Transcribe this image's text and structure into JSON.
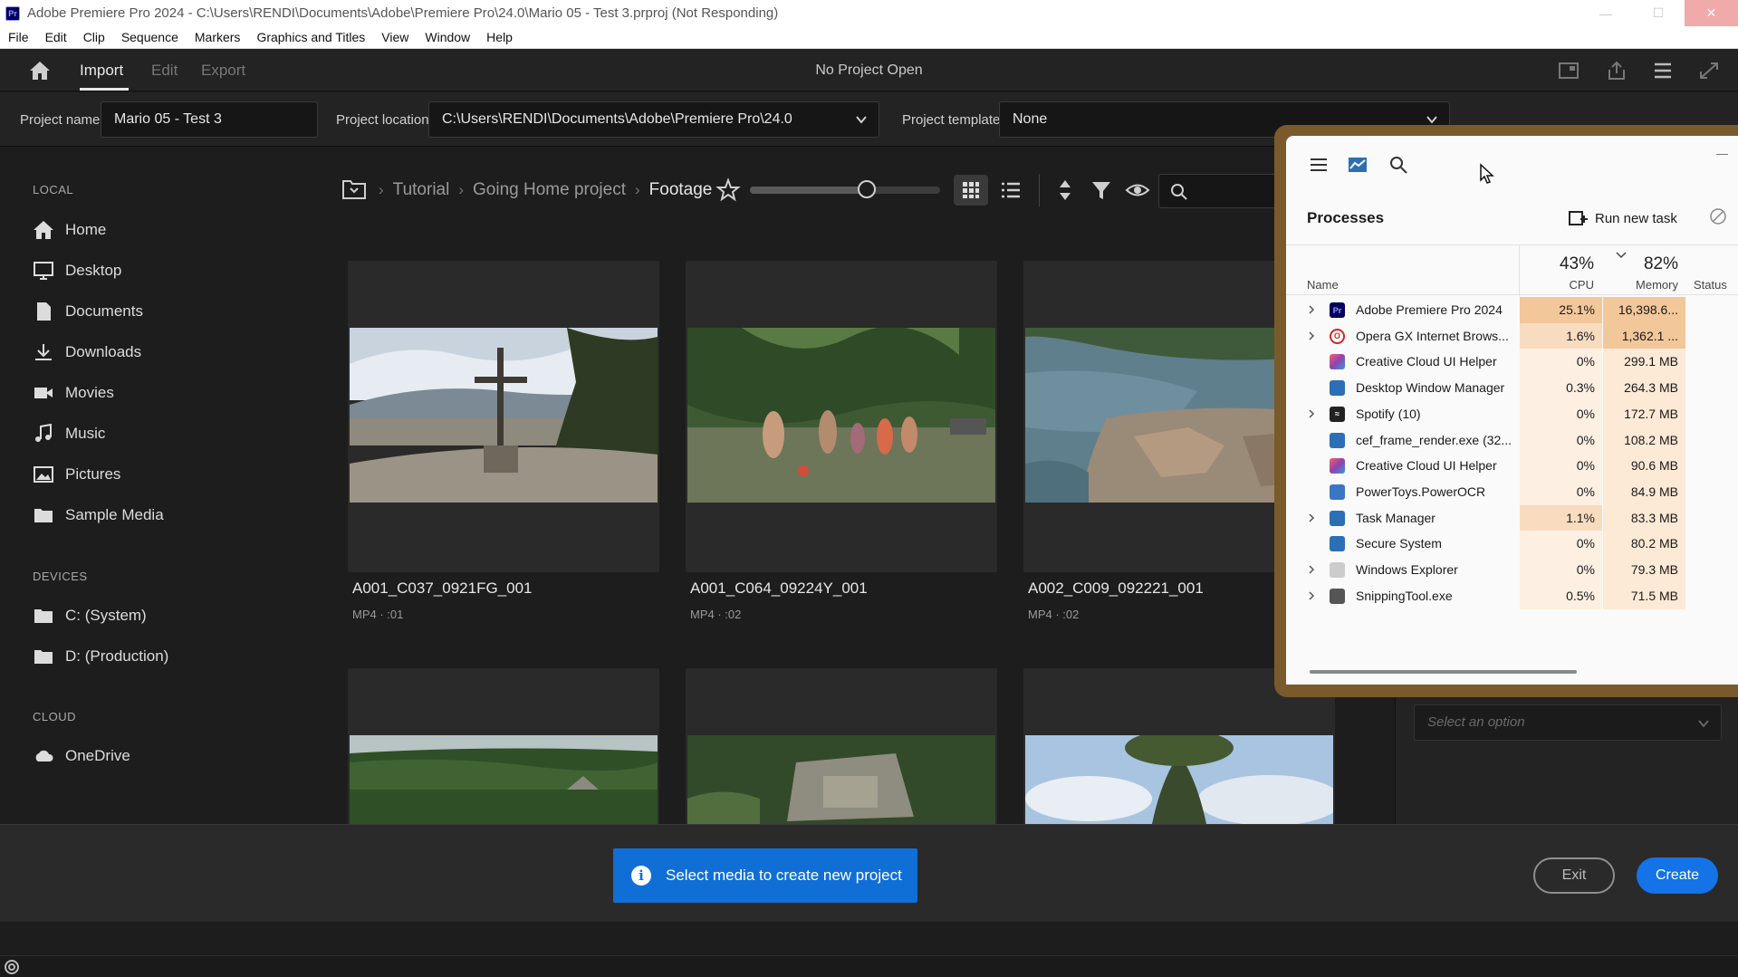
{
  "window": {
    "app_logo": "Pr",
    "title": "Adobe Premiere Pro 2024 - C:\\Users\\RENDI\\Documents\\Adobe\\Premiere Pro\\24.0\\Mario 05 - Test 3.prproj (Not Responding)",
    "minimize": "—",
    "maximize": "☐",
    "close": "✕"
  },
  "menu": [
    "File",
    "Edit",
    "Clip",
    "Sequence",
    "Markers",
    "Graphics and Titles",
    "View",
    "Window",
    "Help"
  ],
  "header": {
    "tabs": [
      "Import",
      "Edit",
      "Export"
    ],
    "active_tab": "Import",
    "center_title": "No Project Open"
  },
  "project": {
    "name_label": "Project name",
    "name_value": "Mario 05 - Test 3",
    "location_label": "Project location",
    "location_value": "C:\\Users\\RENDI\\Documents\\Adobe\\Premiere Pro\\24.0",
    "template_label": "Project template",
    "template_value": "None"
  },
  "sidebar": {
    "local_label": "LOCAL",
    "local_items": [
      "Home",
      "Desktop",
      "Documents",
      "Downloads",
      "Movies",
      "Music",
      "Pictures",
      "Sample Media"
    ],
    "devices_label": "DEVICES",
    "device_items": [
      "C: (System)",
      "D: (Production)"
    ],
    "cloud_label": "CLOUD",
    "cloud_items": [
      "OneDrive"
    ]
  },
  "breadcrumb": [
    "Tutorial",
    "Going Home project",
    "Footage"
  ],
  "thumbnail_size": 0.6,
  "clips": [
    {
      "name": "A001_C037_0921FG_001",
      "meta": "MP4 · :01"
    },
    {
      "name": "A001_C064_09224Y_001",
      "meta": "MP4 · :02"
    },
    {
      "name": "A002_C009_092221_001",
      "meta": "MP4 · :02"
    }
  ],
  "notice": {
    "text": "Select media to create new project",
    "icon": "i"
  },
  "buttons": {
    "exit": "Exit",
    "create": "Create"
  },
  "right_panel": {
    "select_placeholder": "Select an option"
  },
  "task_manager": {
    "title": "Processes",
    "run_new_task": "Run new task",
    "columns": {
      "name": "Name",
      "cpu": "CPU",
      "memory": "Memory",
      "status": "Status"
    },
    "cpu_total": "43%",
    "memory_total": "82%",
    "processes": [
      {
        "name": "Adobe Premiere Pro 2024",
        "cpu": "25.1%",
        "memory": "16,398.6...",
        "expand": true,
        "icon": "premiere-icon"
      },
      {
        "name": "Opera GX Internet Brows...",
        "cpu": "1.6%",
        "memory": "1,362.1 ...",
        "expand": true,
        "icon": "opera-icon"
      },
      {
        "name": "Creative Cloud UI Helper",
        "cpu": "0%",
        "memory": "299.1 MB",
        "expand": false,
        "icon": "creative-cloud-icon"
      },
      {
        "name": "Desktop Window Manager",
        "cpu": "0.3%",
        "memory": "264.3 MB",
        "expand": false,
        "icon": "window-icon"
      },
      {
        "name": "Spotify (10)",
        "cpu": "0%",
        "memory": "172.7 MB",
        "expand": true,
        "icon": "spotify-icon"
      },
      {
        "name": "cef_frame_render.exe (32...",
        "cpu": "0%",
        "memory": "108.2 MB",
        "expand": false,
        "icon": "window-icon"
      },
      {
        "name": "Creative Cloud UI Helper",
        "cpu": "0%",
        "memory": "90.6 MB",
        "expand": false,
        "icon": "creative-cloud-icon"
      },
      {
        "name": "PowerToys.PowerOCR",
        "cpu": "0%",
        "memory": "84.9 MB",
        "expand": false,
        "icon": "powertoys-icon"
      },
      {
        "name": "Task Manager",
        "cpu": "1.1%",
        "memory": "83.3 MB",
        "expand": true,
        "icon": "task-manager-icon"
      },
      {
        "name": "Secure System",
        "cpu": "0%",
        "memory": "80.2 MB",
        "expand": false,
        "icon": "window-icon"
      },
      {
        "name": "Windows Explorer",
        "cpu": "0%",
        "memory": "79.3 MB",
        "expand": true,
        "icon": "folder-icon"
      },
      {
        "name": "SnippingTool.exe",
        "cpu": "0.5%",
        "memory": "71.5 MB",
        "expand": true,
        "icon": "snipping-icon"
      }
    ]
  },
  "colors": {
    "accent_blue": "#1473e6",
    "notice_blue": "#0f6fd6",
    "tm_frame": "#7a5a2a",
    "cpu_heat_high": "#f2c79a",
    "cpu_heat_low": "#fdf0e2"
  }
}
